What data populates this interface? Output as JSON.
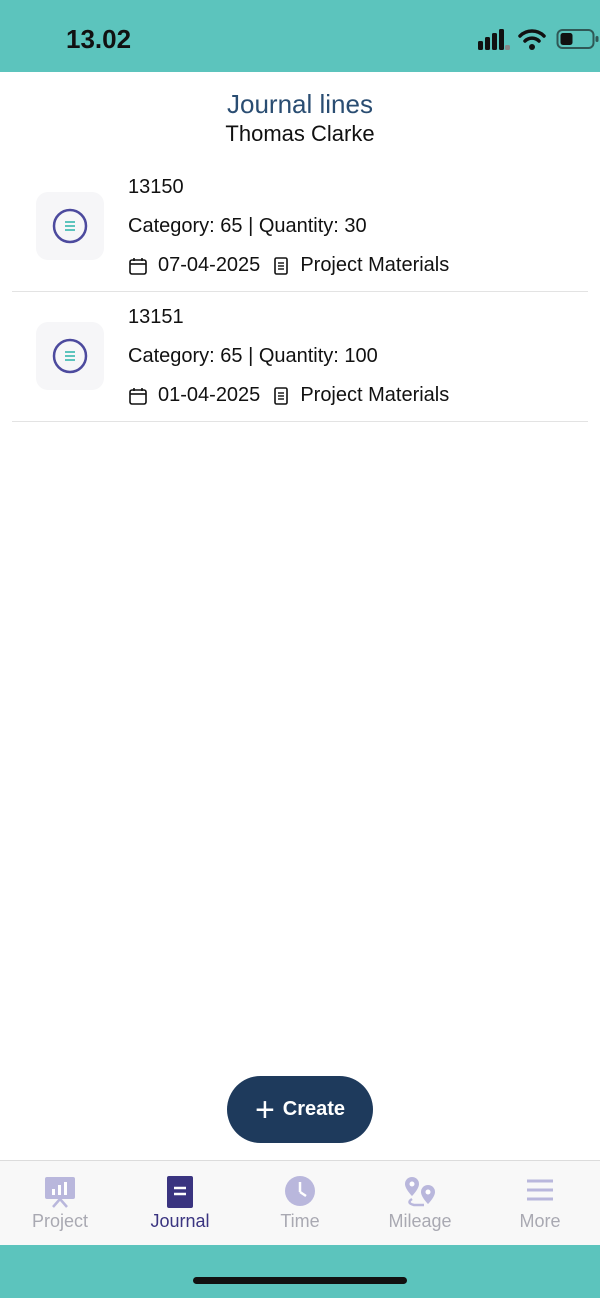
{
  "status_bar": {
    "time": "13.02",
    "battery_level": 0.4
  },
  "header": {
    "title": "Journal lines",
    "subtitle": "Thomas Clarke"
  },
  "journal_lines": [
    {
      "number": "13150",
      "detail": "Category: 65 | Quantity: 30",
      "date": "07-04-2025",
      "type": "Project Materials"
    },
    {
      "number": "13151",
      "detail": "Category: 65 | Quantity: 100",
      "date": "01-04-2025",
      "type": "Project Materials"
    }
  ],
  "create_button": {
    "label": "Create",
    "icon": "plus-icon"
  },
  "tabs": [
    {
      "label": "Project",
      "icon": "presentation-chart-icon",
      "active": false
    },
    {
      "label": "Journal",
      "icon": "journal-book-icon",
      "active": true
    },
    {
      "label": "Time",
      "icon": "clock-icon",
      "active": false
    },
    {
      "label": "Mileage",
      "icon": "route-pin-icon",
      "active": false
    },
    {
      "label": "More",
      "icon": "menu-lines-icon",
      "active": false
    }
  ],
  "colors": {
    "status_bar": "#5cc4bd",
    "title": "#2a4d72",
    "create_button": "#1e3a5c",
    "tab_active": "#3a3480",
    "tab_inactive": "#a9a9b2"
  }
}
